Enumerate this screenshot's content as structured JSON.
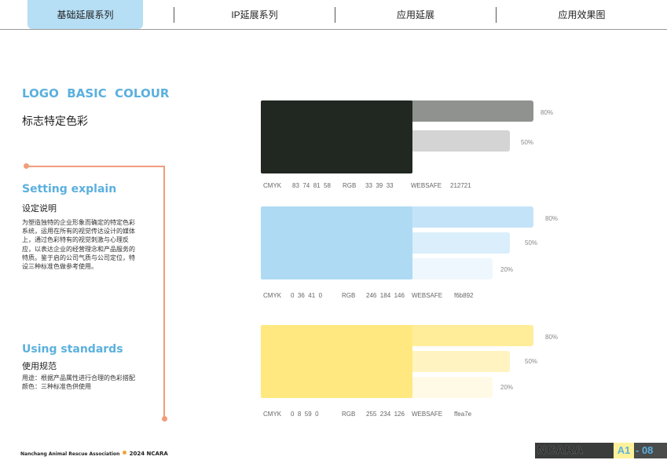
{
  "nav": {
    "tabs": [
      {
        "label": "基础延展系列",
        "active": true
      },
      {
        "label": "IP延展系列",
        "active": false
      },
      {
        "label": "应用延展",
        "active": false
      },
      {
        "label": "应用效果图",
        "active": false
      }
    ]
  },
  "section_title": {
    "en": "LOGO  BASIC  COLOUR",
    "cn": "标志特定色彩"
  },
  "explain": {
    "en": "Setting explain",
    "cn": "设定说明",
    "lines": [
      "为塑造独特的企业形象而确定的特定色彩",
      "系统，运用在所有的视觉传达设计的媒体",
      "上，通过色彩特有的视觉刺激与心理反",
      "应，以表达企业的经营理念和产品服务的",
      "特质。鉴于启的公司气质与公司定位，特",
      "设三种标准色做参考使用。"
    ]
  },
  "standards": {
    "en": "Using standards",
    "cn": "使用规范",
    "lines": [
      "用途：根据产品属性进行合理的色彩搭配",
      "颜色：三种标准色供使用"
    ]
  },
  "colors": [
    {
      "main_color": "#212721",
      "tints": [
        {
          "label": "80%",
          "color": "#8f928f"
        },
        {
          "label": "50%",
          "color": "#d3d4d3"
        }
      ],
      "specs": {
        "cmyk_label": "CMYK",
        "cmyk": "83  74  81  58",
        "rgb_label": "RGB",
        "rgb": "33  39  33",
        "web_label": "WEBSAFE",
        "web": "212721"
      }
    },
    {
      "main_color": "#aedaf3",
      "tints": [
        {
          "label": "80%",
          "color": "#c3e4f8"
        },
        {
          "label": "50%",
          "color": "#daeefb"
        },
        {
          "label": "20%",
          "color": "#eef7fd"
        }
      ],
      "specs": {
        "cmyk_label": "CMYK",
        "cmyk": "0  36  41  0",
        "rgb_label": "RGB",
        "rgb": "246  184  146",
        "web_label": "WEBSAFE",
        "web": "f6b892"
      }
    },
    {
      "main_color": "#ffe87f",
      "tints": [
        {
          "label": "80%",
          "color": "#ffed99"
        },
        {
          "label": "50%",
          "color": "#fff4c1"
        },
        {
          "label": "20%",
          "color": "#fffae6"
        }
      ],
      "specs": {
        "cmyk_label": "CMYK",
        "cmyk": "0  8  59  0",
        "rgb_label": "RGB",
        "rgb": "255  234  126",
        "web_label": "WEBSAFE",
        "web": "ffea7e"
      }
    }
  ],
  "footer": {
    "org": "Nanchang Animal Rescue Association",
    "year": "2024 NCARA",
    "logo": "NCARA",
    "page_section": "A1",
    "page_number": "- 08"
  }
}
